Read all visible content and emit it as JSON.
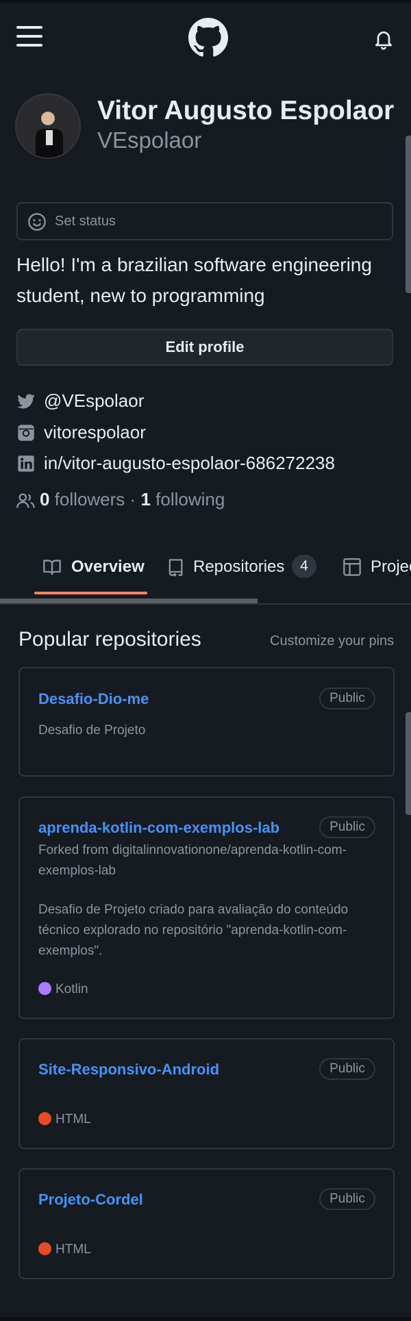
{
  "header": {
    "menu_icon": "hamburger-menu-icon",
    "logo_icon": "github-logo-icon",
    "notifications_icon": "bell-icon"
  },
  "profile": {
    "full_name": "Vitor Augusto Espolaor",
    "username": "VEspolaor",
    "status_placeholder": "Set status",
    "bio": "Hello! I'm a brazilian software engineering student, new to programming",
    "edit_button": "Edit profile",
    "twitter": "@VEspolaor",
    "instagram": "vitorespolaor",
    "linkedin": "in/vitor-augusto-espolaor-686272238",
    "followers_count": "0",
    "followers_label": "followers",
    "separator": "·",
    "following_count": "1",
    "following_label": "following"
  },
  "tabs": [
    {
      "label": "Overview",
      "icon": "book-icon",
      "active": true
    },
    {
      "label": "Repositories",
      "icon": "repo-icon",
      "count": "4"
    },
    {
      "label": "Projects",
      "icon": "table-icon"
    }
  ],
  "pins": {
    "title": "Popular repositories",
    "customize": "Customize your pins",
    "repos": [
      {
        "name": "Desafio-Dio-me",
        "visibility": "Public",
        "description": "Desafio de Projeto"
      },
      {
        "name": "aprenda-kotlin-com-exemplos-lab",
        "visibility": "Public",
        "forked_from": "Forked from digitalinnovationone/aprenda-kotlin-com-exemplos-lab",
        "description": "Desafio de Projeto criado para avaliação do conteúdo técnico explorado no repositório \"aprenda-kotlin-com-exemplos\".",
        "language": "Kotlin",
        "language_color": "#A97BFF"
      },
      {
        "name": "Site-Responsivo-Android",
        "visibility": "Public",
        "language": "HTML",
        "language_color": "#e34c26"
      },
      {
        "name": "Projeto-Cordel",
        "visibility": "Public",
        "language": "HTML",
        "language_color": "#e34c26"
      }
    ]
  },
  "colors": {
    "background": "#161b22",
    "link": "#4493f8",
    "tab_underline": "#f78166",
    "muted_text": "#8b949e"
  }
}
